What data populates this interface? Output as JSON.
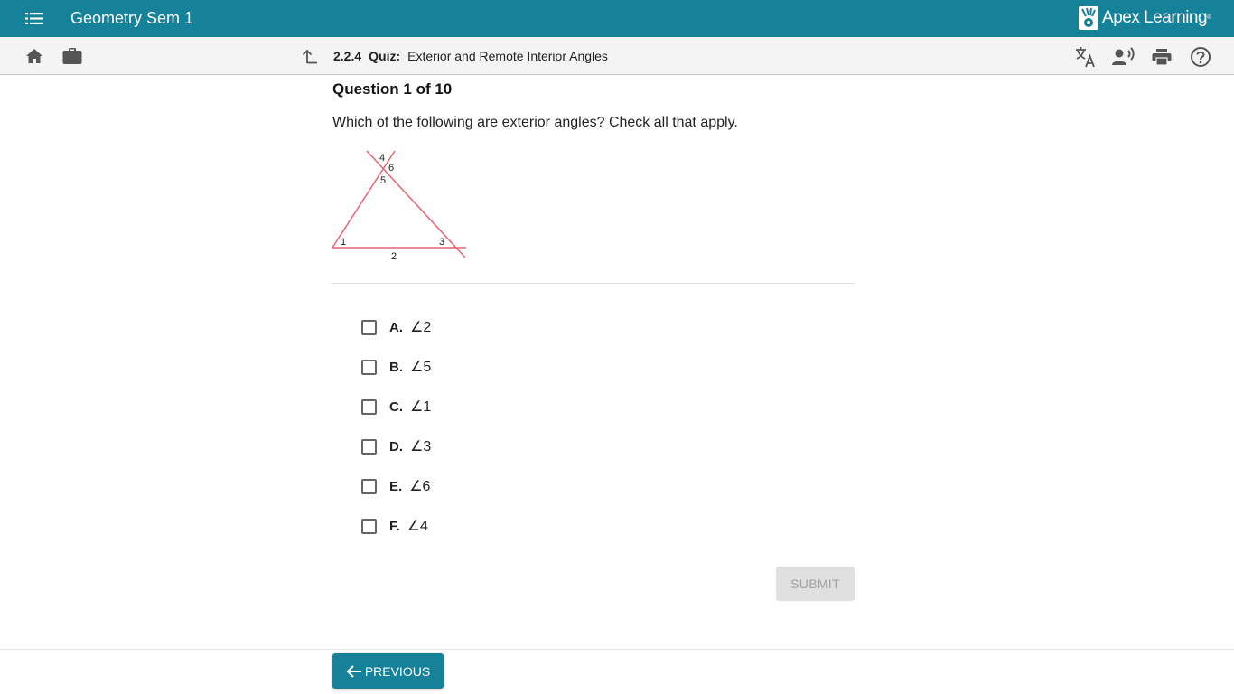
{
  "header": {
    "course_title": "Geometry Sem 1",
    "brand": "Apex Learning",
    "brand_mark": "®",
    "color": "#15829a"
  },
  "toolbar": {
    "left_icons": [
      "home-icon",
      "briefcase-icon"
    ],
    "right_icons": [
      "translate-icon",
      "read-aloud-icon",
      "print-icon",
      "help-icon"
    ]
  },
  "breadcrumb": {
    "icon": "up-arrow-icon",
    "number": "2.2.4",
    "type": "Quiz:",
    "name": "Exterior and Remote Interior Angles"
  },
  "question": {
    "heading": "Question 1 of 10",
    "prompt": "Which of the following are exterior angles? Check all that apply.",
    "diagram_labels": [
      "4",
      "6",
      "5",
      "1",
      "3",
      "2"
    ],
    "choices": [
      {
        "letter": "A.",
        "text": "∠2",
        "checked": false
      },
      {
        "letter": "B.",
        "text": "∠5",
        "checked": false
      },
      {
        "letter": "C.",
        "text": "∠1",
        "checked": false
      },
      {
        "letter": "D.",
        "text": "∠3",
        "checked": false
      },
      {
        "letter": "E.",
        "text": "∠6",
        "checked": false
      },
      {
        "letter": "F.",
        "text": "∠4",
        "checked": false
      }
    ]
  },
  "actions": {
    "submit_label": "SUBMIT",
    "previous_label": "PREVIOUS"
  }
}
